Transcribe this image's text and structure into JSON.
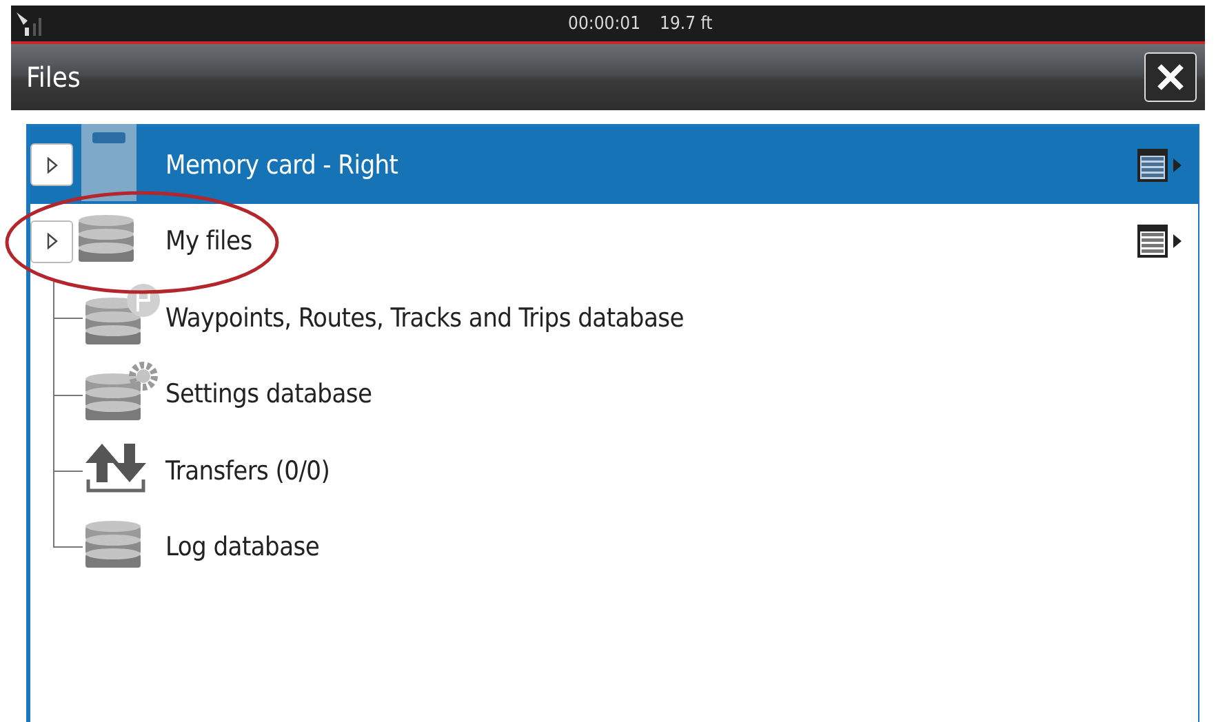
{
  "status_bar": {
    "time": "00:00:01",
    "depth": "19.7 ft"
  },
  "window": {
    "title": "Files"
  },
  "tree": [
    {
      "label": "Memory card - Right",
      "kind": "sd-card",
      "selected": true,
      "expanded": false,
      "has_menu": true
    },
    {
      "label": "My files",
      "kind": "database",
      "selected": false,
      "expanded": false,
      "has_menu": true,
      "highlighted": true,
      "children": [
        {
          "label": "Waypoints, Routes, Tracks and Trips database",
          "kind": "database-flag",
          "selected": false
        },
        {
          "label": "Settings database",
          "kind": "database-gear",
          "selected": false
        },
        {
          "label": "Transfers (0/0)",
          "kind": "transfers",
          "selected": false
        },
        {
          "label": "Log database",
          "kind": "database",
          "selected": false
        }
      ]
    }
  ]
}
